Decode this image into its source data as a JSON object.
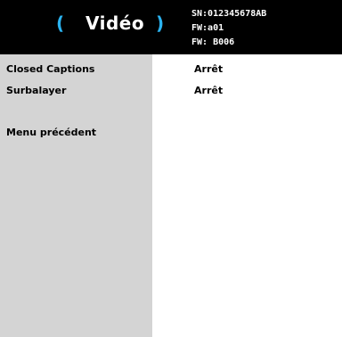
{
  "header": {
    "left_paren": "(",
    "title": "Vidéo",
    "right_paren": ")",
    "serial": "SN:012345678AB",
    "fw_1": "FW:a01",
    "fw_2": "FW: B006"
  },
  "menu": {
    "items": [
      {
        "label": "Closed Captions",
        "value": "Arrêt"
      },
      {
        "label": "Surbalayer",
        "value": "Arrêt"
      }
    ],
    "back_label": "Menu précédent"
  },
  "colors": {
    "header_bg": "#000000",
    "accent": "#2bb3f0",
    "sidebar_bg": "#d4d4d4",
    "content_bg": "#ffffff"
  }
}
